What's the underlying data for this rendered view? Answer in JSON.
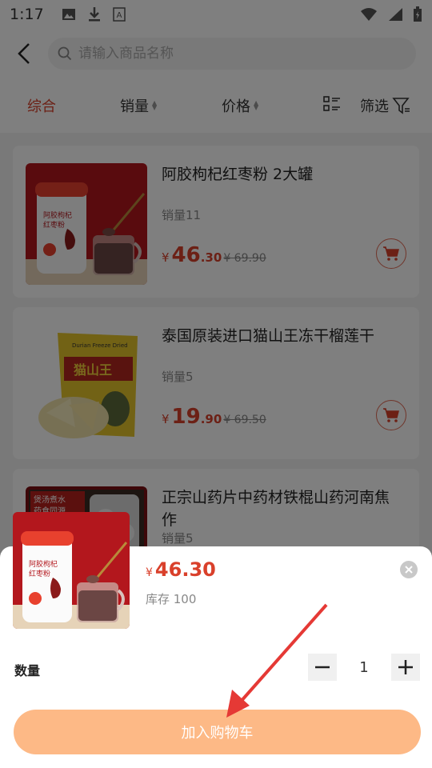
{
  "status_bar": {
    "time": "1:17"
  },
  "search": {
    "placeholder": "请输入商品名称"
  },
  "filters": [
    {
      "label": "综合"
    },
    {
      "label": "销量"
    },
    {
      "label": "价格"
    },
    {
      "label": "筛选"
    }
  ],
  "products": [
    {
      "title": "阿胶枸杞红枣粉 2大罐",
      "sales": "销量11",
      "price_int": "46",
      "price_dec": ".30",
      "price_old": "¥ 69.90",
      "currency": "¥"
    },
    {
      "title": "泰国原装进口猫山王冻干榴莲干",
      "sales": "销量5",
      "price_int": "19",
      "price_dec": ".90",
      "price_old": "¥ 69.50",
      "currency": "¥"
    },
    {
      "title": "正宗山药片中药材铁棍山药河南焦作",
      "sales": "销量5",
      "price_int": "",
      "price_dec": "",
      "price_old": "",
      "currency": ""
    }
  ],
  "product_images": {
    "durian_pack_text": "Durian Freeze Dried",
    "durian_brand": "猫山王",
    "yam_text1": "煲汤煮水",
    "yam_text2": "药食同源"
  },
  "jar_label": {
    "line1": "阿胶枸杞",
    "line2": "红枣粉"
  },
  "sheet": {
    "currency": "¥",
    "price": "46.30",
    "stock": "库存 100",
    "quantity_label": "数量",
    "quantity": "1",
    "add_to_cart": "加入购物车"
  },
  "colors": {
    "accent": "#d9402b",
    "button": "#fdb986",
    "arrow": "#e53935"
  }
}
